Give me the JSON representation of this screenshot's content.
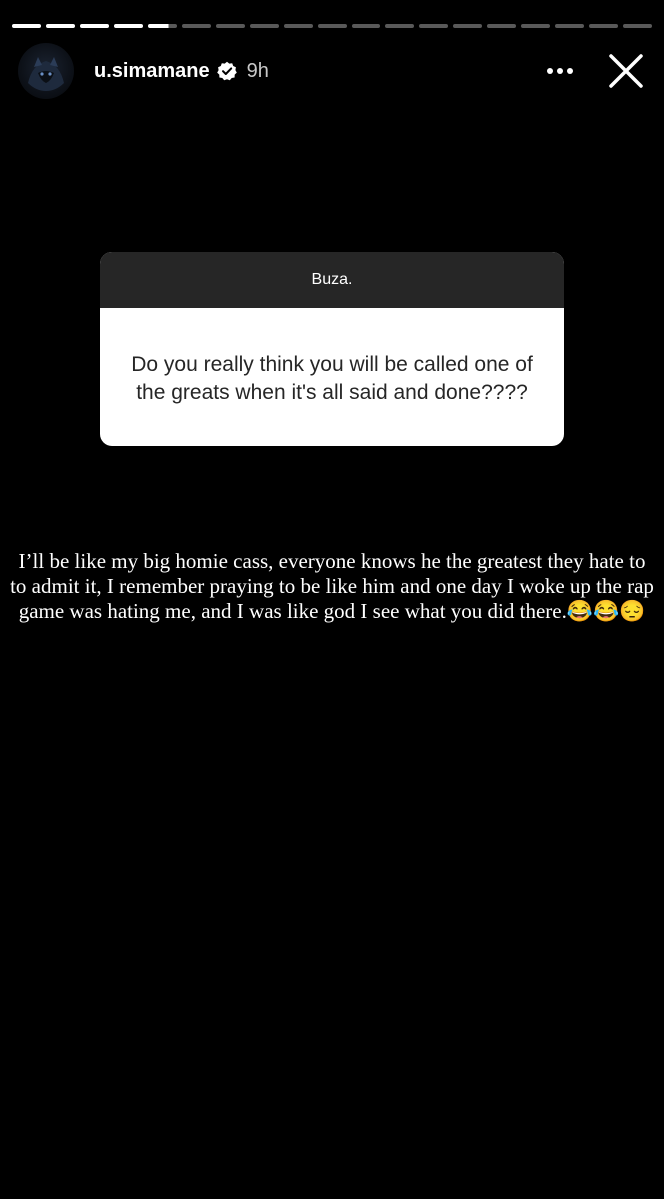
{
  "story": {
    "segments_total": 19,
    "segments_viewed": 4,
    "current_segment": 5,
    "current_segment_progress": 0.7
  },
  "header": {
    "username": "u.simamane",
    "verified": true,
    "time_ago": "9h",
    "more_icon": "more-horizontal-icon",
    "close_icon": "close-icon"
  },
  "question_sticker": {
    "asker": "Buza.",
    "question": "Do you really think you will be called one of the greats when it's all said and done????"
  },
  "answer": {
    "text": "I’ll be like my big homie cass, everyone knows he the greatest they hate to to admit it, I remember praying to be like him and one day I woke up the rap game was hating me, and I was like god I see what you did there.😂😂😔"
  },
  "colors": {
    "background": "#000000",
    "card_header": "#262626",
    "card_body": "#ffffff",
    "verified_badge": "#ffffff"
  }
}
